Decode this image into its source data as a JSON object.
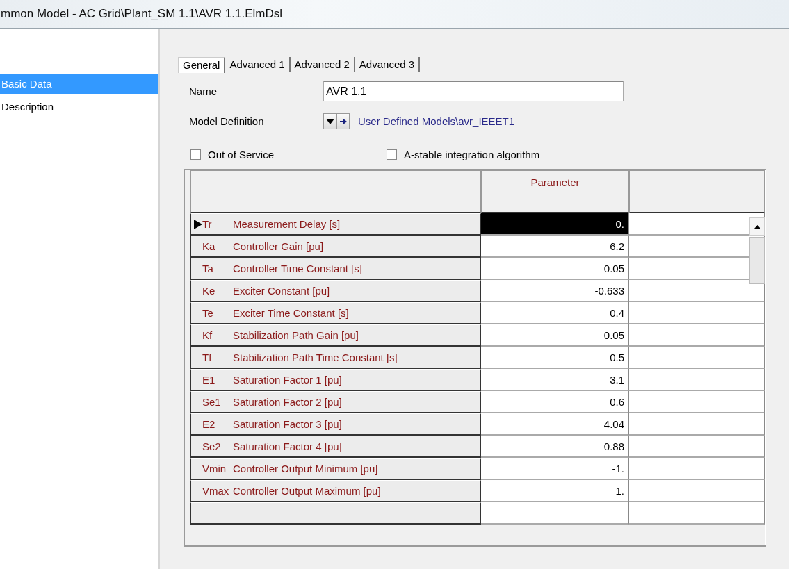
{
  "window": {
    "title": "mmon Model - AC Grid\\Plant_SM 1.1\\AVR 1.1.ElmDsl"
  },
  "sidebar": {
    "items": [
      {
        "label": "Basic Data",
        "selected": true
      },
      {
        "label": "Description",
        "selected": false
      }
    ]
  },
  "tabs": [
    {
      "label": "General",
      "selected": true
    },
    {
      "label": "Advanced 1",
      "selected": false
    },
    {
      "label": "Advanced 2",
      "selected": false
    },
    {
      "label": "Advanced 3",
      "selected": false
    }
  ],
  "name": {
    "label": "Name",
    "value": "AVR 1.1"
  },
  "model_definition": {
    "label": "Model Definition",
    "link": "User Defined Models\\avr_IEEET1"
  },
  "options": [
    {
      "label": "Out of Service",
      "checked": false
    },
    {
      "label": "A-stable integration algorithm",
      "checked": false
    }
  ],
  "table": {
    "columns": [
      "Parameter"
    ],
    "rows": [
      {
        "symbol": "Tr",
        "description": "Measurement Delay [s]",
        "value": "0.",
        "selected": true
      },
      {
        "symbol": "Ka",
        "description": "Controller Gain [pu]",
        "value": "6.2",
        "selected": false
      },
      {
        "symbol": "Ta",
        "description": "Controller Time Constant [s]",
        "value": "0.05",
        "selected": false
      },
      {
        "symbol": "Ke",
        "description": "Exciter Constant [pu]",
        "value": "-0.633",
        "selected": false
      },
      {
        "symbol": "Te",
        "description": "Exciter Time Constant [s]",
        "value": "0.4",
        "selected": false
      },
      {
        "symbol": "Kf",
        "description": "Stabilization Path Gain [pu]",
        "value": "0.05",
        "selected": false
      },
      {
        "symbol": "Tf",
        "description": "Stabilization Path Time Constant [s]",
        "value": "0.5",
        "selected": false
      },
      {
        "symbol": "E1",
        "description": "Saturation Factor 1 [pu]",
        "value": "3.1",
        "selected": false
      },
      {
        "symbol": "Se1",
        "description": "Saturation Factor 2 [pu]",
        "value": "0.6",
        "selected": false
      },
      {
        "symbol": "E2",
        "description": "Saturation Factor 3 [pu]",
        "value": "4.04",
        "selected": false
      },
      {
        "symbol": "Se2",
        "description": "Saturation Factor 4 [pu]",
        "value": "0.88",
        "selected": false
      },
      {
        "symbol": "Vmin",
        "description": "Controller Output Minimum [pu]",
        "value": "-1.",
        "selected": false
      },
      {
        "symbol": "Vmax",
        "description": "Controller Output Maximum [pu]",
        "value": "1.",
        "selected": false
      }
    ]
  }
}
